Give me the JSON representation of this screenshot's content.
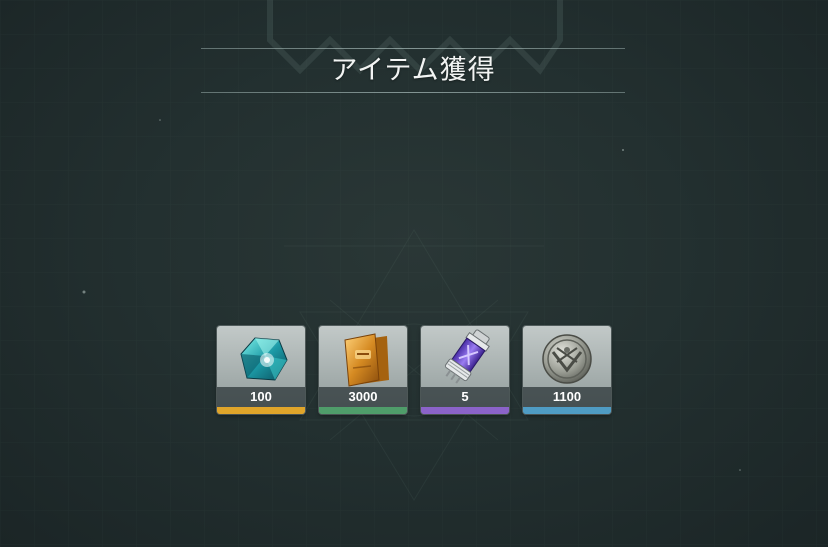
{
  "title": "アイテム獲得",
  "items": [
    {
      "icon": "crystal-gem-icon",
      "count": "100",
      "rarity_color": "#e0a52a"
    },
    {
      "icon": "gold-bars-icon",
      "count": "3000",
      "rarity_color": "#4f9d6a"
    },
    {
      "icon": "purple-capsule-icon",
      "count": "5",
      "rarity_color": "#8b63c9"
    },
    {
      "icon": "silver-coin-icon",
      "count": "1100",
      "rarity_color": "#4f9cc4"
    }
  ]
}
